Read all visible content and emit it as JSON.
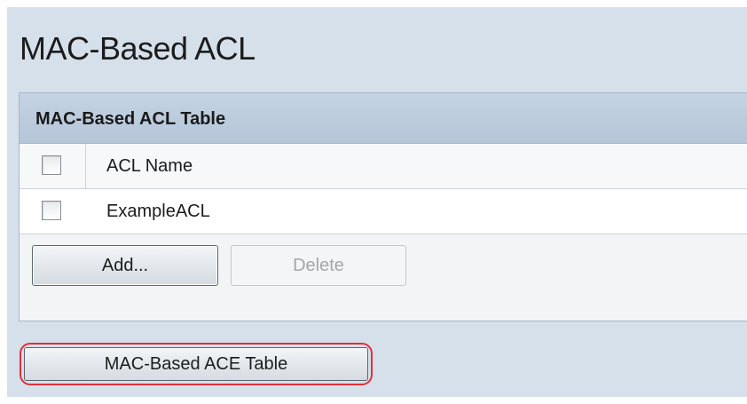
{
  "page": {
    "title": "MAC-Based ACL"
  },
  "table": {
    "caption": "MAC-Based ACL Table",
    "column_header": "ACL Name",
    "rows": [
      {
        "name": "ExampleACL",
        "checked": false
      }
    ]
  },
  "buttons": {
    "add_label": "Add...",
    "delete_label": "Delete",
    "delete_disabled": true,
    "ace_table_label": "MAC-Based ACE Table"
  },
  "colors": {
    "background": "#d6e0ea",
    "table_header": "#c4d3e3",
    "highlight_outline": "#e0303a"
  }
}
